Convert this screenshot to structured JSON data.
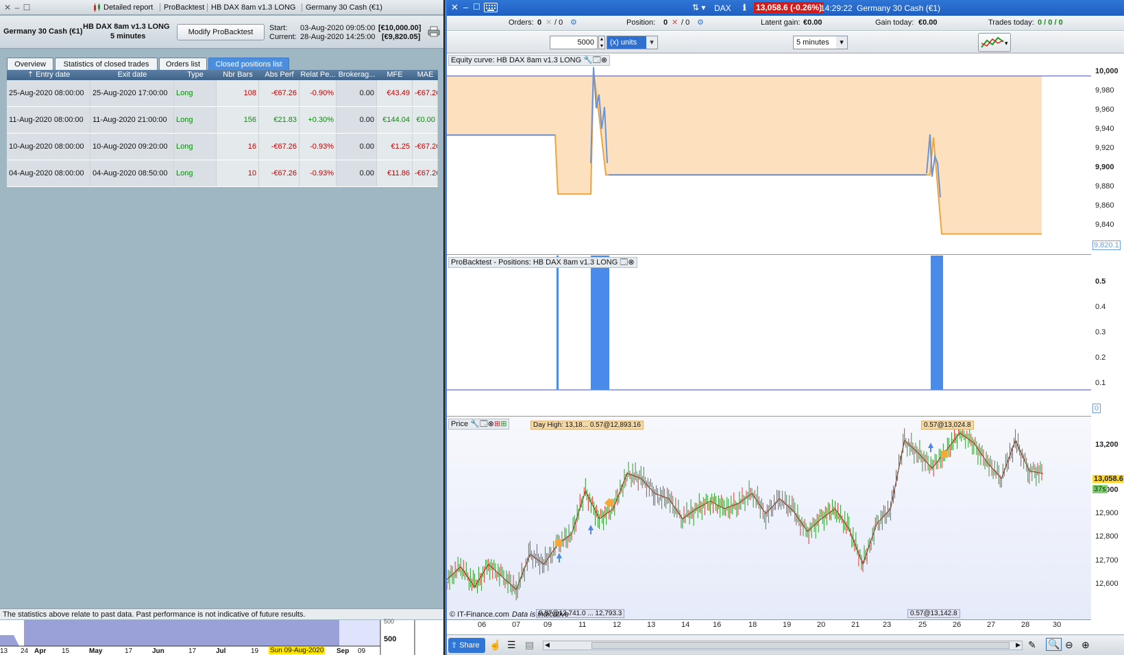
{
  "left_window": {
    "title_icon": "candlestick-icon",
    "title_parts": [
      "Detailed report",
      "ProBacktest",
      "HB DAX 8am v1.3  LONG",
      "Germany 30 Cash (€1)"
    ],
    "instrument": "Germany 30 Cash (€1)",
    "system_name": "HB DAX 8am v1.3  LONG",
    "timeframe": "5 minutes",
    "modify_button": "Modify ProBacktest",
    "start_label": "Start:",
    "start_date": "03-Aug-2020 09:05:00",
    "start_value": "[€10,000.00]",
    "current_label": "Current:",
    "current_date": "28-Aug-2020 14:25:00",
    "current_value": "[€9,820.05]",
    "tabs": [
      "Overview",
      "Statistics of closed trades",
      "Orders list",
      "Closed positions list"
    ],
    "active_tab": "Closed positions list",
    "columns": [
      "Entry date",
      "Exit date",
      "Type",
      "Nbr Bars",
      "Abs Perf",
      "Relat Pe...",
      "Brokerag...",
      "MFE",
      "MAE"
    ],
    "rows": [
      {
        "entry": "25-Aug-2020 08:00:00",
        "exit": "25-Aug-2020 17:00:00",
        "type": "Long",
        "bars": "108",
        "abs": "-€67.26",
        "rel": "-0.90%",
        "brok": "0.00",
        "mfe": "€43.49",
        "mae": "-€67.26"
      },
      {
        "entry": "11-Aug-2020 08:00:00",
        "exit": "11-Aug-2020 21:00:00",
        "type": "Long",
        "bars": "156",
        "abs": "€21.83",
        "rel": "+0.30%",
        "brok": "0.00",
        "mfe": "€144.04",
        "mae": "€0.00"
      },
      {
        "entry": "10-Aug-2020 08:00:00",
        "exit": "10-Aug-2020 09:20:00",
        "type": "Long",
        "bars": "16",
        "abs": "-€67.26",
        "rel": "-0.93%",
        "brok": "0.00",
        "mfe": "€1.25",
        "mae": "-€67.26"
      },
      {
        "entry": "04-Aug-2020 08:00:00",
        "exit": "04-Aug-2020 08:50:00",
        "type": "Long",
        "bars": "10",
        "abs": "-€67.26",
        "rel": "-0.93%",
        "brok": "0.00",
        "mfe": "€11.86",
        "mae": "-€67.26"
      }
    ],
    "footer_text": "The statistics above relate to past data. Past performance is not indicative of future results.",
    "mini_chart": {
      "labels": [
        "13",
        "24",
        "Apr",
        "15",
        "May",
        "17",
        "Jun",
        "17",
        "Jul",
        "19",
        "Sun 09-Aug-2020",
        "Sep",
        "09"
      ],
      "axis_labels": [
        "500",
        "500"
      ]
    }
  },
  "right_window": {
    "symbol": "DAX",
    "price_badge": "13,058.6 (-0.26%)",
    "time": "14:29:22",
    "instrument": "Germany 30 Cash (€1)",
    "orders_label": "Orders:",
    "orders_value": "0",
    "orders_sep": "/ 0",
    "position_label": "Position:",
    "position_value": "0",
    "position_sep": "/ 0",
    "latent_label": "Latent gain:",
    "latent_value": "€0.00",
    "gain_today_label": "Gain today:",
    "gain_today_value": "€0.00",
    "trades_today_label": "Trades today:",
    "trades_today_value": "0 / 0 / 0",
    "quantity": "5000",
    "units": "(x) units",
    "timeframe": "5 minutes",
    "equity_title": "Equity curve: HB DAX 8am v1.3  LONG",
    "equity_axis": [
      "10,000",
      "9,980",
      "9,960",
      "9,940",
      "9,920",
      "9,900",
      "9,880",
      "9,860",
      "9,840"
    ],
    "equity_last": "9,820.1",
    "positions_title": "ProBacktest - Positions: HB DAX 8am v1.3  LONG",
    "positions_axis": [
      "0.5",
      "0.4",
      "0.3",
      "0.2",
      "0.1"
    ],
    "positions_zero": "0",
    "price_title": "Price",
    "price_subtitle": "Day High: 13,18... 0.57@12,893.16",
    "tag_top": "0.57@13,024.8",
    "tag_bottom_left": "0.57@12,741.0 ... 12,793.3",
    "tag_bottom_right": "0.57@13,142.8",
    "copyright": "© IT-Finance.com",
    "data_note": "Data is indicative",
    "price_axis": [
      "13,200",
      "13,000",
      "12,900",
      "12,800",
      "12,700",
      "12,600"
    ],
    "price_last": "13,058.6",
    "price_countdown": "37s",
    "x_axis": [
      "06",
      "07",
      "09",
      "11",
      "12",
      "13",
      "14",
      "16",
      "18",
      "19",
      "20",
      "21",
      "23",
      "25",
      "26",
      "27",
      "28",
      "30"
    ],
    "share_button": "Share"
  },
  "chart_data": [
    {
      "type": "area",
      "title": "Equity curve: HB DAX 8am v1.3  LONG",
      "x": [
        "06",
        "07",
        "09",
        "11",
        "12",
        "13",
        "14",
        "16",
        "18",
        "19",
        "20",
        "21",
        "23",
        "25",
        "26",
        "27",
        "28",
        "30"
      ],
      "ylim": [
        9815,
        10010
      ],
      "series": [
        {
          "name": "Equity",
          "values": [
            9932.7,
            9932.7,
            9932.7,
            9865.5,
            9865.5,
            10005,
            9955,
            9887.3,
            9887.3,
            9887.3,
            9887.3,
            9887.3,
            9887.3,
            9887.3,
            9930,
            9820.1,
            9820.1,
            9820.1
          ]
        }
      ],
      "start_level": 10000
    },
    {
      "type": "bar",
      "title": "ProBacktest - Positions: HB DAX 8am v1.3  LONG",
      "ylim": [
        0,
        0.57
      ],
      "intervals": [
        {
          "from": "04-Aug-2020 08:00",
          "to": "04-Aug-2020 08:50",
          "value": 0.57
        },
        {
          "from": "10-Aug-2020 08:00",
          "to": "10-Aug-2020 09:20",
          "value": 0.57
        },
        {
          "from": "11-Aug-2020 08:00",
          "to": "11-Aug-2020 21:00",
          "value": 0.57
        },
        {
          "from": "25-Aug-2020 08:00",
          "to": "25-Aug-2020 17:00",
          "value": 0.57
        }
      ]
    },
    {
      "type": "line",
      "title": "Price",
      "ylim": [
        12550,
        13260
      ],
      "series": [
        {
          "name": "Germany 30 Cash (€1)",
          "values": [
            12640,
            12690,
            12610,
            12700,
            12650,
            12600,
            12740,
            12700,
            12780,
            12820,
            12990,
            12880,
            12920,
            13060,
            13040,
            12980,
            12960,
            12880,
            12920,
            12950,
            12920,
            12940,
            12980,
            12900,
            12960,
            12910,
            12830,
            12880,
            12920,
            12840,
            12700,
            12860,
            12920,
            13190,
            13140,
            13080,
            13150,
            13220,
            13180,
            13100,
            13040,
            13190,
            13070,
            13058.6
          ]
        }
      ]
    }
  ]
}
